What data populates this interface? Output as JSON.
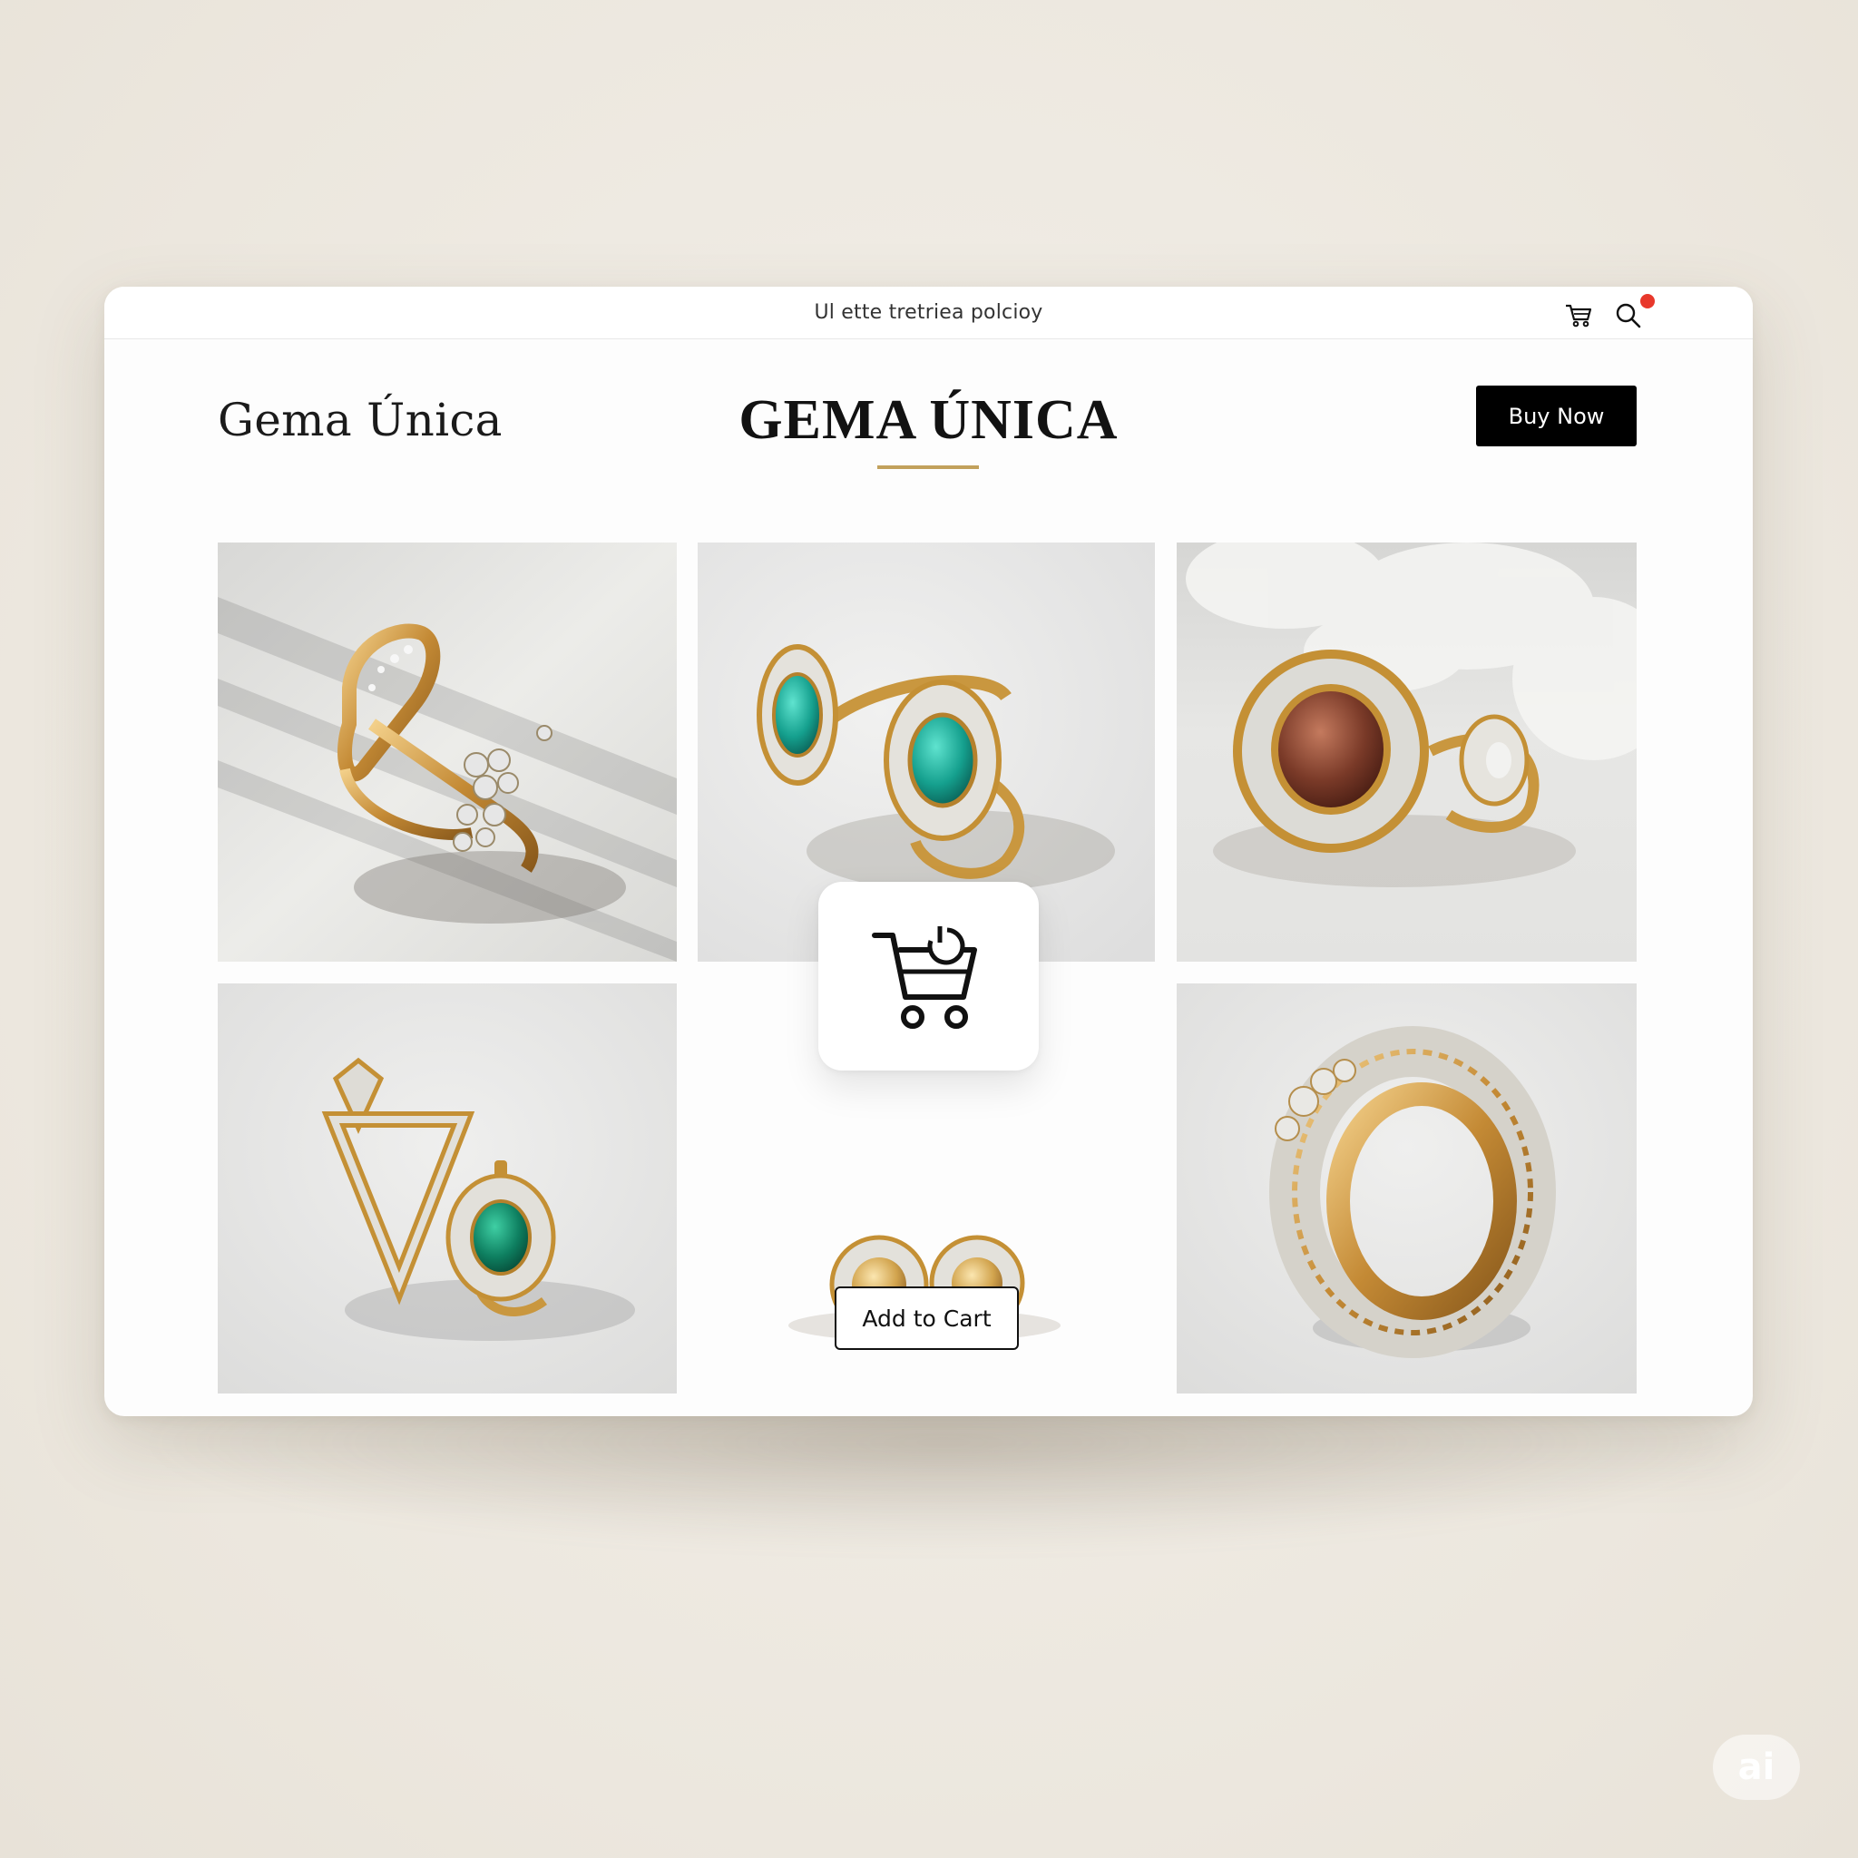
{
  "titlebar": {
    "title": "Ul ette tretriea polcioy"
  },
  "header": {
    "brand_left": "Gema Única",
    "brand_center": "GEMA ÚNICA",
    "buy_label": "Buy Now"
  },
  "icons": {
    "titlebar": [
      "cart-icon",
      "search-icon",
      "notification-dot"
    ],
    "overlay": "add-to-cart-icon"
  },
  "products": [
    {
      "kind": "gold ring with diamond cluster",
      "background": "light grey with window shadows"
    },
    {
      "kind": "gold rings with teal oval stones",
      "background": "light grey"
    },
    {
      "kind": "gold ring with brown oval stone",
      "background": "white fabric"
    },
    {
      "kind": "triangle earring and teal stone ring",
      "background": "light grey"
    },
    {
      "kind": "gold stud earrings pair",
      "background": "white"
    },
    {
      "kind": "gold pavé diamond ring",
      "background": "light grey"
    }
  ],
  "actions": {
    "add_to_cart_label": "Add to Cart"
  },
  "watermark": "ai",
  "colors": {
    "page_bg": "#efebe3",
    "accent_gold": "#c2a15c",
    "button_dark": "#000000",
    "notification": "#e8382b"
  }
}
